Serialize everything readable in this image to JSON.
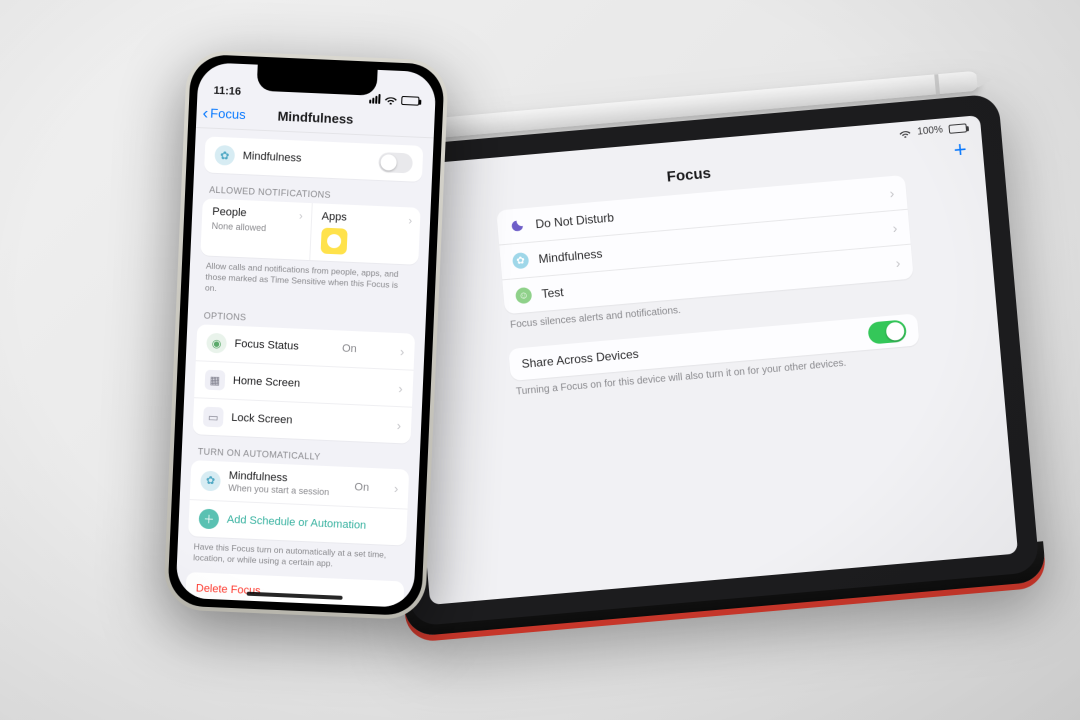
{
  "iphone": {
    "status": {
      "time": "11:16"
    },
    "nav": {
      "back": "Focus",
      "title": "Mindfulness"
    },
    "master": {
      "label": "Mindfulness",
      "on": false
    },
    "allowed": {
      "header": "ALLOWED NOTIFICATIONS",
      "people": {
        "title": "People",
        "sub": "None allowed"
      },
      "apps": {
        "title": "Apps"
      },
      "footer": "Allow calls and notifications from people, apps, and those marked as Time Sensitive when this Focus is on."
    },
    "options": {
      "header": "OPTIONS",
      "focus_status": {
        "label": "Focus Status",
        "value": "On"
      },
      "home_screen": {
        "label": "Home Screen"
      },
      "lock_screen": {
        "label": "Lock Screen"
      }
    },
    "auto": {
      "header": "TURN ON AUTOMATICALLY",
      "item": {
        "label": "Mindfulness",
        "sub": "When you start a session",
        "value": "On"
      },
      "add": "Add Schedule or Automation",
      "footer": "Have this Focus turn on automatically at a set time, location, or while using a certain app."
    },
    "delete": "Delete Focus"
  },
  "ipad": {
    "status": {
      "battery": "100%"
    },
    "title": "Focus",
    "modes": [
      {
        "label": "Do Not Disturb",
        "icon": "moon"
      },
      {
        "label": "Mindfulness",
        "icon": "mind"
      },
      {
        "label": "Test",
        "icon": "test"
      }
    ],
    "modes_footer": "Focus silences alerts and notifications.",
    "share": {
      "label": "Share Across Devices",
      "on": true,
      "footer": "Turning a Focus on for this device will also turn it on for your other devices."
    }
  }
}
